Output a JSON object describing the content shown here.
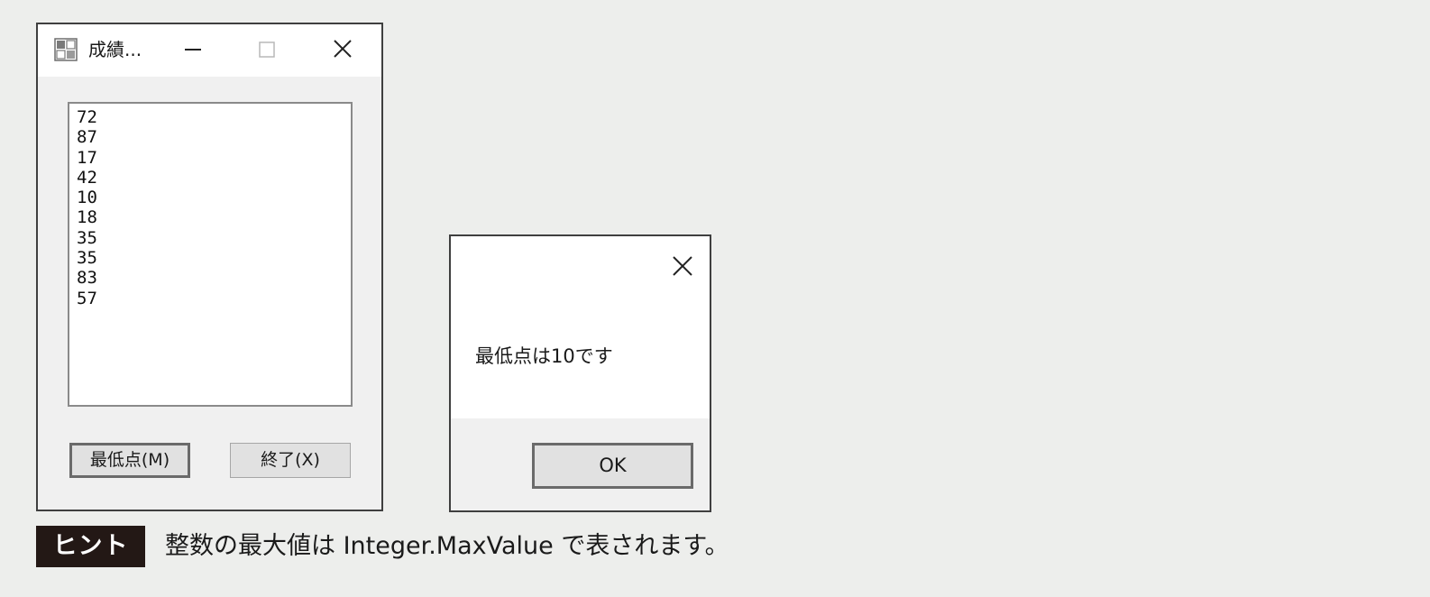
{
  "main_window": {
    "title": "成績...",
    "icon": "app-icon",
    "titlebar_buttons": [
      "minimize-icon",
      "maximize-icon",
      "close-icon"
    ],
    "list_items": [
      "72",
      "87",
      "17",
      "42",
      "10",
      "18",
      "35",
      "35",
      "83",
      "57"
    ],
    "min_button_label": "最低点(M)",
    "end_button_label": "終了(X)"
  },
  "message_box": {
    "message": "最低点は10です",
    "ok_label": "OK",
    "close_icon": "close-icon"
  },
  "hint": {
    "badge": "ヒント",
    "text": "整数の最大値は Integer.MaxValue で表されます。"
  },
  "colors": {
    "page_background": "#edeeec",
    "window_face": "#f0f0f0",
    "window_border": "#3f3f3f",
    "button_face": "#e1e1e1",
    "hint_badge": "#231815"
  }
}
